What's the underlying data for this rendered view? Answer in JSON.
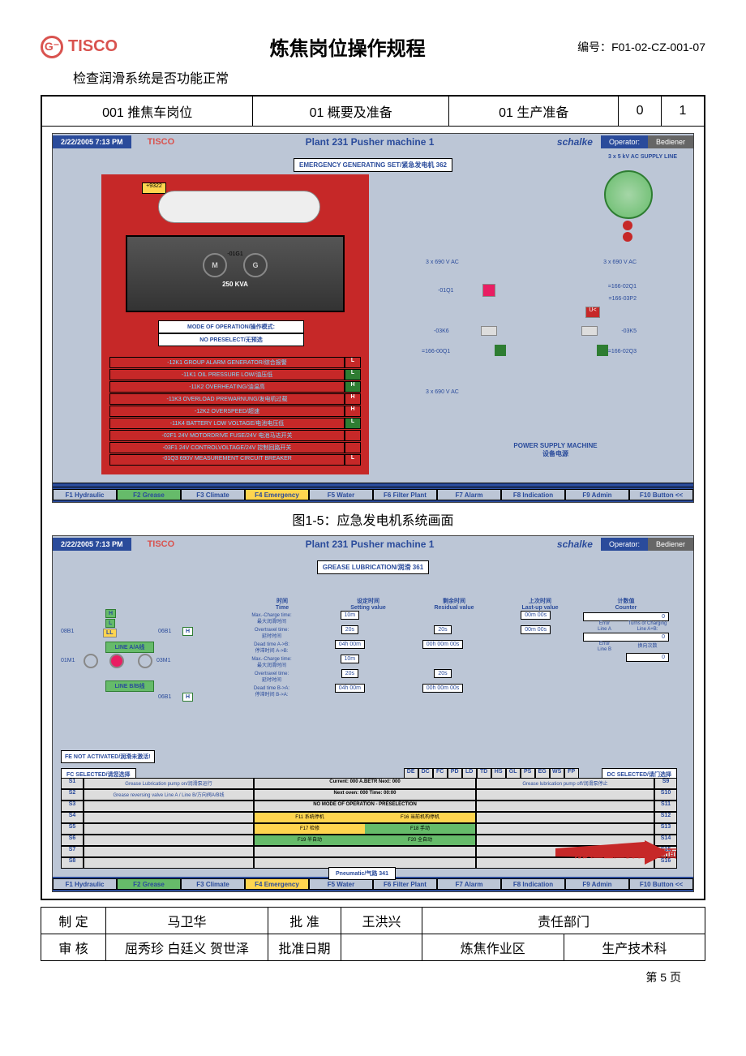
{
  "header": {
    "logo_text": "TISCO",
    "logo_icon": "G⁻",
    "title": "炼焦岗位操作规程",
    "doc_no_label": "编号：",
    "doc_no": "F01-02-CZ-001-07"
  },
  "subtitle": "检查润滑系统是否功能正常",
  "top_row": {
    "c1": "001 推焦车岗位",
    "c2": "01 概要及准备",
    "c3": "01 生产准备",
    "c4": "0",
    "c5": "1"
  },
  "screen1": {
    "date": "2/22/2005 7:13 PM",
    "tisco": "TISCO",
    "plant": "Plant 231 Pusher machine 1",
    "schalke": "schalke",
    "operator": "Operator:",
    "bediener": "Bediener",
    "emerg": "EMERGENCY GENERATING SET/紧急发电机 362",
    "ybox": "+9322",
    "mg_m": "M",
    "mg_g": "G",
    "mg_label": "-01G1",
    "kva": "250 KVA",
    "mode1": "MODE OF OPERATION/操作模式:",
    "mode2": "NO PRESELECT/无预选",
    "alarms": [
      {
        "t": "-12K1 GROUP ALARM GENERATOR/综合报警",
        "i": "L",
        "c": "ind-L"
      },
      {
        "t": "-11K1 OIL PRESSURE LOW/油压低",
        "i": "L",
        "c": "ind-H"
      },
      {
        "t": "-11K2 OVERHEATING/油温高",
        "i": "H",
        "c": "ind-H"
      },
      {
        "t": "-11K3 OVERLOAD PREWARNUNG/发电机过载",
        "i": "H",
        "c": "ind-L"
      },
      {
        "t": "-12K2 OVERSPEED/超速",
        "i": "H",
        "c": "ind-L"
      },
      {
        "t": "-11K4 BATTERY LOW VOLTAGE/电池电压低",
        "i": "L",
        "c": "ind-H"
      },
      {
        "t": "-02F1 24V MOTORDRIVE FUSE/24V 电池马达开关",
        "i": "",
        "c": "ind-L"
      },
      {
        "t": "-03F1 24V CONTROLVOLTAGE/24V 控制回路开关",
        "i": "",
        "c": "ind-L"
      },
      {
        "t": "-01Q3 690V MEASUREMENT CIRCUIT BREAKER",
        "i": "L",
        "c": "ind-L"
      }
    ],
    "supply": "3 x 5 kV AC  SUPPLY LINE",
    "wires": {
      "w1": "3 x 690 V AC",
      "w2": "-01Q1",
      "w3": "-03K6",
      "w4": "=166-00Q1",
      "w5": "3 x 690 V AC",
      "w6": "=166-02Q1",
      "w7": "=166-03P2",
      "w8": "U<",
      "w9": "-03K5",
      "w10": "=166-02Q3",
      "w11": "3 x 690 V AC"
    },
    "power_supply": "POWER SUPPLY MACHINE\n设备电源",
    "fbar": [
      "F1 Hydraulic",
      "F2 Grease",
      "F3 Climate",
      "F4 Emergency",
      "F5 Water",
      "F6 Filter Plant",
      "F7 Alarm",
      "F8 Indication",
      "F9 Admin",
      "F10 Button <<"
    ]
  },
  "caption1": "图1-5：应急发电机系统画面",
  "screen2": {
    "date": "2/22/2005 7:13 PM",
    "grease": "GREASE LUBRICATION/润滑 361",
    "lube": {
      "h": "H",
      "l": "L",
      "ll": "LL",
      "b1": "08B1",
      "b2": "06B1",
      "b3": "06B1",
      "m1": "01M1",
      "m2": "03M1",
      "lineA": "LINE A/A线",
      "lineB": "LINE B/B线"
    },
    "time_heads": {
      "c1a": "时间",
      "c1b": "Time",
      "c2a": "设定时间",
      "c2b": "Setting value",
      "c3a": "剩余时间",
      "c3b": "Residual value",
      "c4a": "上次时间",
      "c4b": "Last-up value",
      "c5a": "计数值",
      "c5b": "Counter"
    },
    "time_rows": [
      {
        "l1": "Max.-Charge time:",
        "l2": "最大润滑时间",
        "v1": "10m",
        "v2": "",
        "v3": "00m 00s"
      },
      {
        "l1": "Overtravel time:",
        "l2": "延时时间",
        "v1": "20s",
        "v2": "20s",
        "v3": "00m 00s"
      },
      {
        "l1": "Dead time A->B:",
        "l2": "停滞时间 A->B:",
        "v1": "04h 00m",
        "v2": "00h 00m 00s",
        "v3": ""
      },
      {
        "l1": "Max.-Charge time:",
        "l2": "最大润滑时间",
        "v1": "10m",
        "v2": "",
        "v3": ""
      },
      {
        "l1": "Overtravel time:",
        "l2": "延时时间",
        "v1": "20s",
        "v2": "20s",
        "v3": ""
      },
      {
        "l1": "Dead time B->A:",
        "l2": "停滞时间 B->A:",
        "v1": "04h 00m",
        "v2": "00h 00m 00s",
        "v3": ""
      }
    ],
    "counters": {
      "turns": "Turns of\nCharging\nLine A+B:",
      "cycles": "换向次数",
      "errA_l": "Error\nLine A",
      "errB_l": "Error\nLine B",
      "v0": "0",
      "v1": "0",
      "v2": "0"
    },
    "fe": "FE NOT ACTIVATED/润滑未激活!",
    "fc_sel": "FC  SELECTED/请您选择",
    "dc_sel": "DC  SELECTED/请门选择",
    "fc_cells": [
      "DE",
      "DC",
      "FC",
      "PD",
      "LD",
      "TD",
      "HS",
      "GL",
      "PS",
      "EG",
      "WS",
      "FP"
    ],
    "s_rows": [
      {
        "l": "S1",
        "m1": "Grease Lubrication pump on/润滑泵运行",
        "m2": "Current:  000      A.BETR       Next:      000",
        "m3": "Grease lubrication pump off/润滑泵停止",
        "r": "S9"
      },
      {
        "l": "S2",
        "m1": "Grease reversing valve Line A / Line B/方向阀A/B线",
        "m2": "Next oven:            000          Time:   00:00",
        "m3": "",
        "r": "S10"
      },
      {
        "l": "S3",
        "m1": "",
        "m2": "NO MODE OF OPERATION - PRESELECTION",
        "m3": "",
        "r": "S11"
      },
      {
        "l": "S4",
        "m1": "",
        "m2": "",
        "m3": "",
        "r": "S12"
      },
      {
        "l": "S5",
        "m1": "",
        "m2": "",
        "m3": "",
        "r": "S13"
      },
      {
        "l": "S6",
        "m1": "",
        "m2": "",
        "m3": "",
        "r": "S14"
      },
      {
        "l": "S7",
        "m1": "",
        "m2": "",
        "m3": "",
        "r": "S15"
      },
      {
        "l": "S8",
        "m1": "",
        "m2": "",
        "m3": "",
        "r": "S16"
      }
    ],
    "btns": {
      "f11": "F11 系统停机",
      "f16": "F16 当前机构停机",
      "f17": "F17 检修",
      "f18": "F18 手动",
      "f19": "F19 半自动",
      "f20": "F20 全自动"
    },
    "pneumatic": "Pneumatic/气路 341",
    "arrow_text": "切换至空压机系统画面"
  },
  "footer": {
    "r1c1": "制 定",
    "r1c2": "马卫华",
    "r1c3": "批 准",
    "r1c4": "王洪兴",
    "r1c5": "责任部门",
    "r2c1": "审 核",
    "r2c2": "屈秀珍 白廷义 贺世泽",
    "r2c3": "批准日期",
    "r2c4": "",
    "r2c5": "炼焦作业区",
    "r2c6": "生产技术科"
  },
  "page_no": "第 5 页"
}
